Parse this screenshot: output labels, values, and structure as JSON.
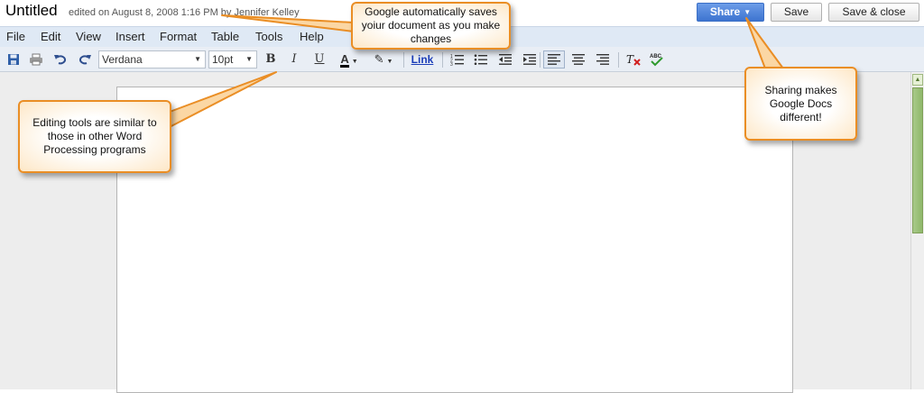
{
  "header": {
    "title": "Untitled",
    "edited": "edited on August 8, 2008 1:16 PM by Jennifer Kelley",
    "share_label": "Share",
    "save_label": "Save",
    "save_close_label": "Save & close"
  },
  "menu": [
    "File",
    "Edit",
    "View",
    "Insert",
    "Format",
    "Table",
    "Tools",
    "Help"
  ],
  "toolbar": {
    "font": "Verdana",
    "size": "10pt",
    "bold": "B",
    "italic": "I",
    "underline": "U",
    "text_color": "A",
    "link": "Link",
    "spell": "ABC"
  },
  "callouts": {
    "autosave": "Google automatically saves yoiur document as you make changes",
    "editing": "Editing tools are similar to those in other Word Processing programs",
    "sharing": "Sharing makes Google Docs different!"
  },
  "colors": {
    "menubar": "#dfe9f5",
    "share": "#3d74d0",
    "callout_border": "#ea8e25"
  }
}
